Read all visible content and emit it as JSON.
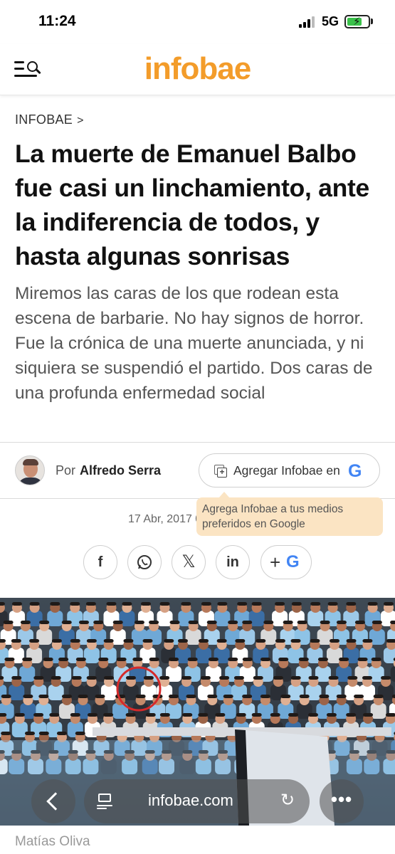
{
  "status_bar": {
    "time": "11:24",
    "network": "5G",
    "battery_level": 0.7
  },
  "header": {
    "logo": "infobae",
    "menu_icon": "menu-search-icon"
  },
  "article": {
    "breadcrumb": "INFOBAE",
    "breadcrumb_chevron": ">",
    "headline": "La muerte de Emanuel Balbo fue casi un linchamiento, ante la indiferencia de todos, y hasta algunas sonrisas",
    "dek": "Miremos las caras de los que rodean esta escena de barbarie. No hay signos de horror. Fue la crónica de una muerte anunciada, y ni siquiera se suspendió el partido. Dos caras de una profunda enfermedad social",
    "byline_prefix": "Por",
    "author": "Alfredo Serra",
    "google_button_label": "Agregar Infobae en",
    "tooltip": "Agrega Infobae a tus medios preferidos en Google",
    "date": "17 Abr, 2017 0",
    "photo_credit": "Matías Oliva"
  },
  "share": {
    "facebook": "f",
    "twitter": "𝕏",
    "linkedin": "in",
    "more_plus": "+"
  },
  "browser": {
    "url": "infobae.com",
    "more": "•••"
  },
  "colors": {
    "brand": "#f39c2a",
    "tooltip_bg": "#fbe4c3",
    "whatsapp": "#333333"
  }
}
